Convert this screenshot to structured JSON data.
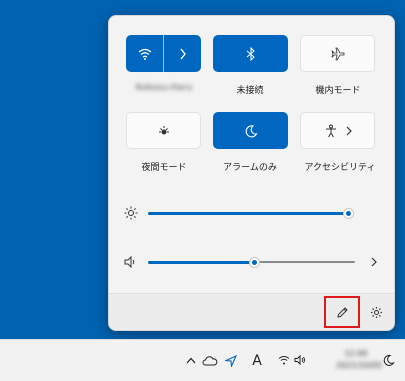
{
  "quick_settings": {
    "tiles": [
      {
        "id": "wifi",
        "label": "Kokosu-Haru",
        "state": "on",
        "icon": "wifi-icon",
        "has_chevron": true
      },
      {
        "id": "bluetooth",
        "label": "未接続",
        "state": "on",
        "icon": "bluetooth-icon"
      },
      {
        "id": "airplane",
        "label": "機内モード",
        "state": "off",
        "icon": "airplane-icon"
      },
      {
        "id": "night_light",
        "label": "夜間モード",
        "state": "off",
        "icon": "night-light-icon"
      },
      {
        "id": "focus_assist",
        "label": "アラームのみ",
        "state": "on",
        "icon": "moon-icon"
      },
      {
        "id": "accessibility",
        "label": "アクセシビリティ",
        "state": "off",
        "icon": "accessibility-icon",
        "has_chevron": true
      }
    ],
    "brightness": {
      "icon": "brightness-icon",
      "level": 1.0
    },
    "volume": {
      "icon": "speaker-icon",
      "level": 0.5,
      "chevron": "chevron-right-icon"
    },
    "footer": {
      "edit_icon": "pencil-icon",
      "settings_icon": "gear-icon"
    }
  },
  "taskbar": {
    "tray_icons": [
      "chevron-up-icon",
      "cloud-icon",
      "location-icon"
    ],
    "ime_label": "A",
    "time": "12:00",
    "date": "2021/10/05",
    "notification_icon": "moon-icon"
  },
  "colors": {
    "accent": "#0067c0",
    "desktop": "#0063b1",
    "highlight": "#e0191b"
  }
}
